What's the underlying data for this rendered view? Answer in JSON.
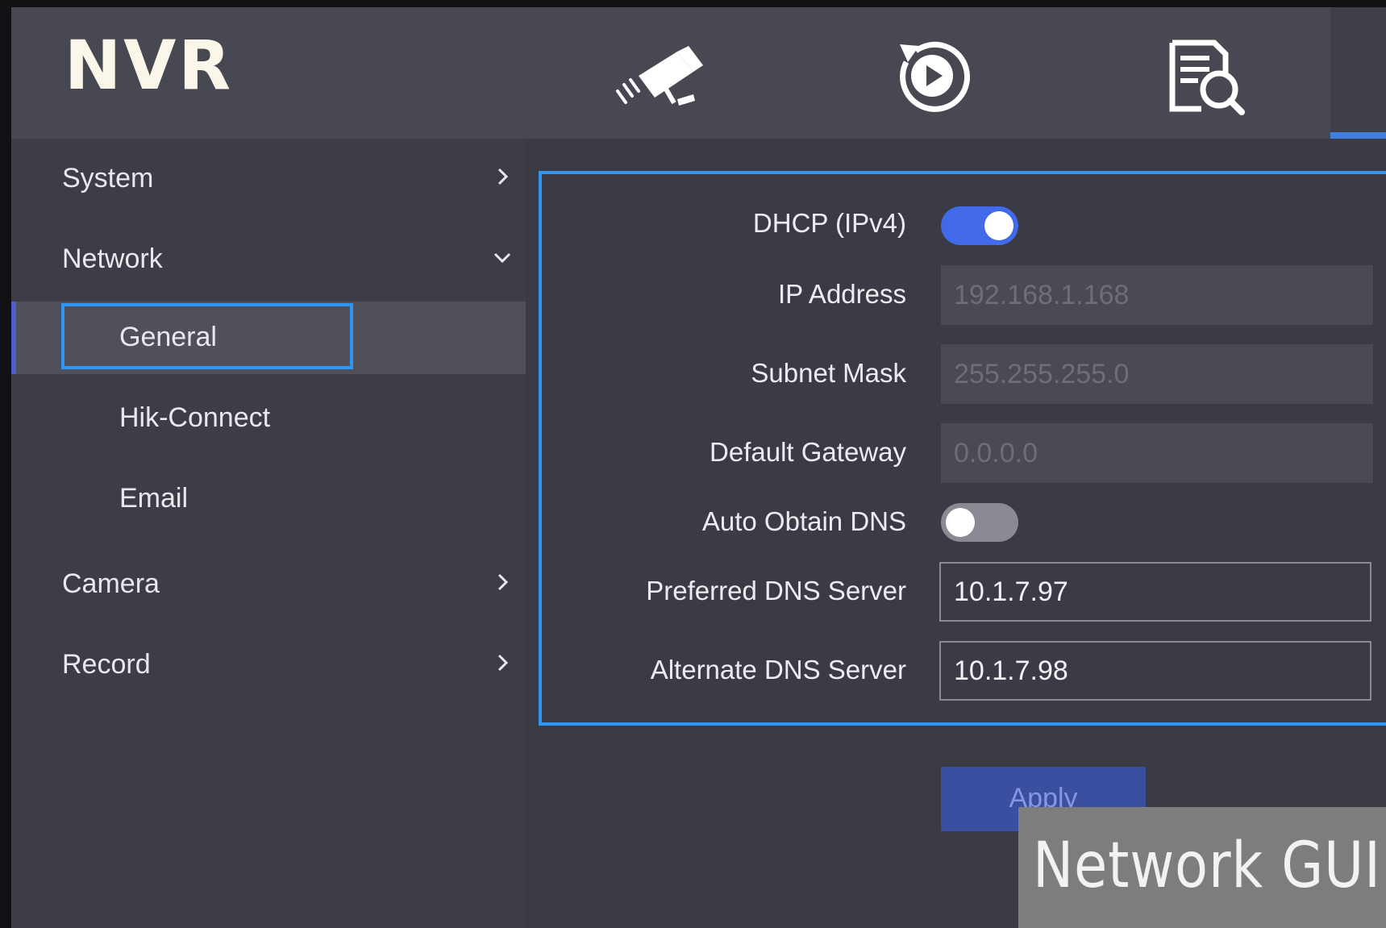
{
  "app": {
    "logo": "NVR",
    "nav_icons": [
      "camera-icon",
      "playback-icon",
      "file-search-icon"
    ]
  },
  "sidebar": {
    "items": [
      {
        "label": "System",
        "icon": "chevron-right-icon"
      },
      {
        "label": "Network",
        "icon": "chevron-down-icon"
      },
      {
        "label": "Camera",
        "icon": "chevron-right-icon"
      },
      {
        "label": "Record",
        "icon": "chevron-right-icon"
      }
    ],
    "network_sub": [
      {
        "label": "General",
        "active": true
      },
      {
        "label": "Hik-Connect",
        "active": false
      },
      {
        "label": "Email",
        "active": false
      }
    ]
  },
  "form": {
    "dhcp": {
      "label": "DHCP (IPv4)",
      "enabled": true
    },
    "ip_address": {
      "label": "IP Address",
      "value": "192.168.1.168"
    },
    "subnet_mask": {
      "label": "Subnet Mask",
      "value": "255.255.255.0"
    },
    "default_gateway": {
      "label": "Default Gateway",
      "value": "0.0.0.0"
    },
    "auto_dns": {
      "label": "Auto Obtain DNS",
      "enabled": false
    },
    "preferred_dns": {
      "label": "Preferred DNS Server",
      "value": "10.1.7.97"
    },
    "alternate_dns": {
      "label": "Alternate DNS Server",
      "value": "10.1.7.98"
    },
    "apply_label": "Apply"
  },
  "watermark": {
    "text": "Network GUI"
  },
  "colors": {
    "accent": "#2f97f0",
    "toggle_on": "#4169e8",
    "apply_button": "#3a4fa0"
  }
}
